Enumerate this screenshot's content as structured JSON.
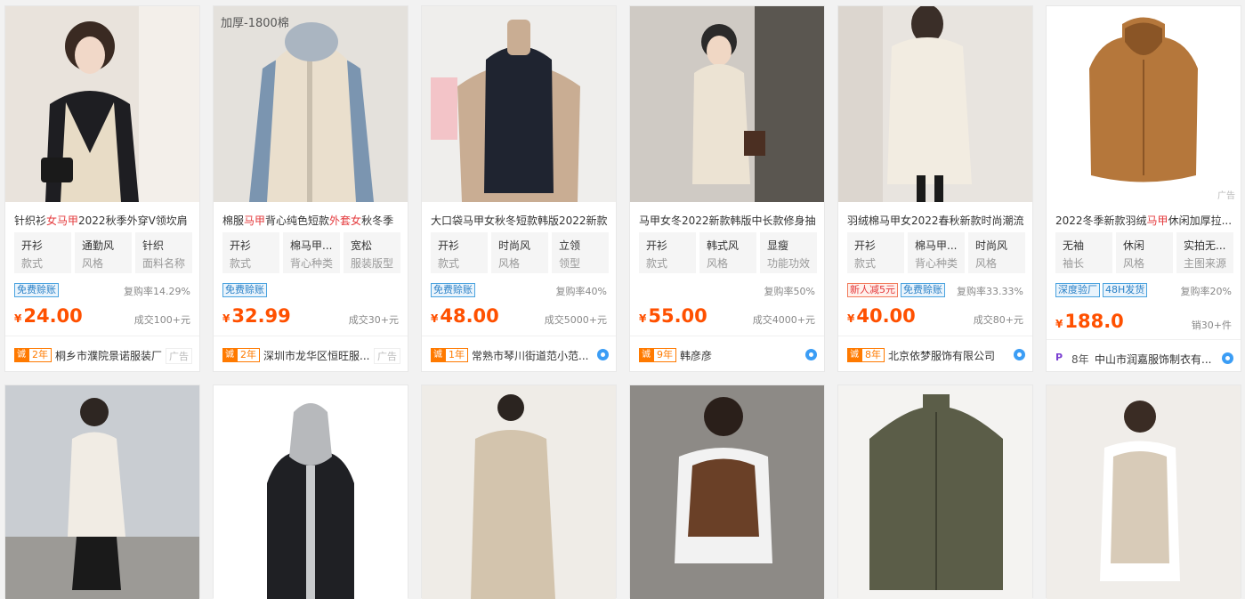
{
  "colors": {
    "price": "#ff5000",
    "highlight": "#e4393c",
    "tag_blue": "#2a80c6",
    "badge_orange": "#ff7a00"
  },
  "products": [
    {
      "title_parts": [
        {
          "t": "针织衫",
          "h": false
        },
        {
          "t": "女马甲",
          "h": true
        },
        {
          "t": "2022秋季外穿V领坎肩",
          "h": false
        }
      ],
      "attrs": [
        {
          "v": "开衫",
          "k": "款式"
        },
        {
          "v": "通勤风",
          "k": "风格"
        },
        {
          "v": "针织",
          "k": "面料名称"
        }
      ],
      "tags": [
        {
          "t": "免费赊账",
          "red": false
        }
      ],
      "rate": "复购率14.29%",
      "currency": "¥",
      "price": "24.00",
      "sold": "成交100+元",
      "badge_icon": "诚",
      "years": "2年",
      "shop": "桐乡市濮院景诺服装厂",
      "footer_ad": "广告"
    },
    {
      "image_caption": "加厚-1800棉",
      "title_parts": [
        {
          "t": "棉服",
          "h": false
        },
        {
          "t": "马甲",
          "h": true
        },
        {
          "t": "背心纯色短款",
          "h": false
        },
        {
          "t": "外套女",
          "h": true
        },
        {
          "t": "秋冬季",
          "h": false
        }
      ],
      "attrs": [
        {
          "v": "开衫",
          "k": "款式"
        },
        {
          "v": "棉马甲...",
          "k": "背心种类"
        },
        {
          "v": "宽松",
          "k": "服装版型"
        }
      ],
      "tags": [
        {
          "t": "免费赊账",
          "red": false
        }
      ],
      "rate": "",
      "currency": "¥",
      "price": "32.99",
      "sold": "成交30+元",
      "badge_icon": "诚",
      "years": "2年",
      "shop": "深圳市龙华区恒旺服...",
      "footer_ad": "广告"
    },
    {
      "title_parts": [
        {
          "t": "大口袋马甲女秋冬短款韩版2022新款",
          "h": false
        }
      ],
      "attrs": [
        {
          "v": "开衫",
          "k": "款式"
        },
        {
          "v": "时尚风",
          "k": "风格"
        },
        {
          "v": "立领",
          "k": "领型"
        }
      ],
      "tags": [
        {
          "t": "免费赊账",
          "red": false
        }
      ],
      "rate": "复购率40%",
      "currency": "¥",
      "price": "48.00",
      "sold": "成交5000+元",
      "badge_icon": "诚",
      "years": "1年",
      "shop": "常熟市琴川街道范小范..."
    },
    {
      "title_parts": [
        {
          "t": "马甲女冬2022新款韩版中长款修身抽",
          "h": false
        }
      ],
      "attrs": [
        {
          "v": "开衫",
          "k": "款式"
        },
        {
          "v": "韩式风",
          "k": "风格"
        },
        {
          "v": "显瘦",
          "k": "功能功效"
        }
      ],
      "tags": [],
      "rate": "复购率50%",
      "currency": "¥",
      "price": "55.00",
      "sold": "成交4000+元",
      "badge_icon": "诚",
      "years": "9年",
      "shop": "韩彦彦"
    },
    {
      "title_parts": [
        {
          "t": "羽绒棉马甲女2022春秋新款时尚潮流",
          "h": false
        }
      ],
      "attrs": [
        {
          "v": "开衫",
          "k": "款式"
        },
        {
          "v": "棉马甲...",
          "k": "背心种类"
        },
        {
          "v": "时尚风",
          "k": "风格"
        }
      ],
      "tags": [
        {
          "t": "新人减5元",
          "red": true
        },
        {
          "t": "免费赊账",
          "red": false
        }
      ],
      "rate": "复购率33.33%",
      "currency": "¥",
      "price": "40.00",
      "sold": "成交80+元",
      "badge_icon": "诚",
      "years": "8年",
      "shop": "北京依梦服饰有限公司"
    },
    {
      "image_ad": "广告",
      "title_parts": [
        {
          "t": "2022冬季新款羽绒",
          "h": false
        },
        {
          "t": "马甲",
          "h": true
        },
        {
          "t": "休闲加厚拉...",
          "h": false
        }
      ],
      "attrs": [
        {
          "v": "无袖",
          "k": "袖长"
        },
        {
          "v": "休闲",
          "k": "风格"
        },
        {
          "v": "实拍无...",
          "k": "主图来源"
        }
      ],
      "tags": [
        {
          "t": "深度验厂",
          "red": false
        },
        {
          "t": "48H发货",
          "red": false
        }
      ],
      "rate": "复购率20%",
      "currency": "¥",
      "price": "188.0",
      "sold": "销30+件",
      "badge_icon": "P",
      "years": "8年",
      "shop": "中山市润嘉服饰制衣有..."
    }
  ]
}
